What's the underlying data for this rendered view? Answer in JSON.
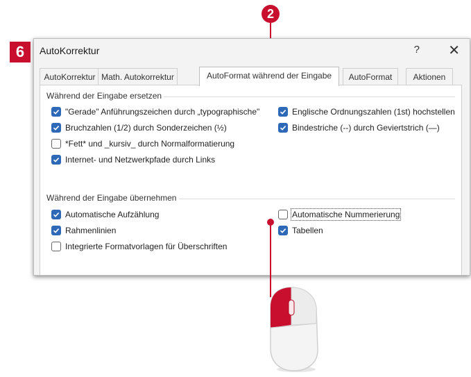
{
  "annotations": {
    "step_badge": "6",
    "step_circle": "2"
  },
  "window": {
    "title": "AutoKorrektur",
    "help_label": "?",
    "close_label": "✕"
  },
  "tabs": [
    {
      "label": "AutoKorrektur",
      "active": false
    },
    {
      "label": "Math. Autokorrektur",
      "active": false
    },
    {
      "label": "AutoFormat während der Eingabe",
      "active": true
    },
    {
      "label": "AutoFormat",
      "active": false
    },
    {
      "label": "Aktionen",
      "active": false
    }
  ],
  "group_replace": {
    "title": "Während der Eingabe ersetzen",
    "items": [
      {
        "label": "\"Gerade\" Anführungszeichen durch „typographische\"",
        "checked": true
      },
      {
        "label": "Englische Ordnungszahlen (1st) hochstellen",
        "checked": true
      },
      {
        "label": "Bruchzahlen (1/2) durch Sonderzeichen (½)",
        "checked": true
      },
      {
        "label": "Bindestriche (--) durch Geviertstrich (—)",
        "checked": true
      },
      {
        "label": "*Fett* und _kursiv_ durch Normalformatierung",
        "checked": false
      },
      {
        "label": "Internet- und Netzwerkpfade durch Links",
        "checked": true
      }
    ]
  },
  "group_apply": {
    "title": "Während der Eingabe übernehmen",
    "items": [
      {
        "label": "Automatische Aufzählung",
        "checked": true
      },
      {
        "label": "Automatische Nummerierung",
        "checked": false,
        "focused": true
      },
      {
        "label": "Rahmenlinien",
        "checked": true
      },
      {
        "label": "Tabellen",
        "checked": true
      },
      {
        "label": "Integrierte Formatvorlagen für Überschriften",
        "checked": false
      }
    ]
  },
  "colors": {
    "accent": "#c8102e",
    "checkbox": "#2d69b7"
  },
  "icons": {
    "check": "checkmark-icon",
    "mouse": "mouse-icon"
  }
}
